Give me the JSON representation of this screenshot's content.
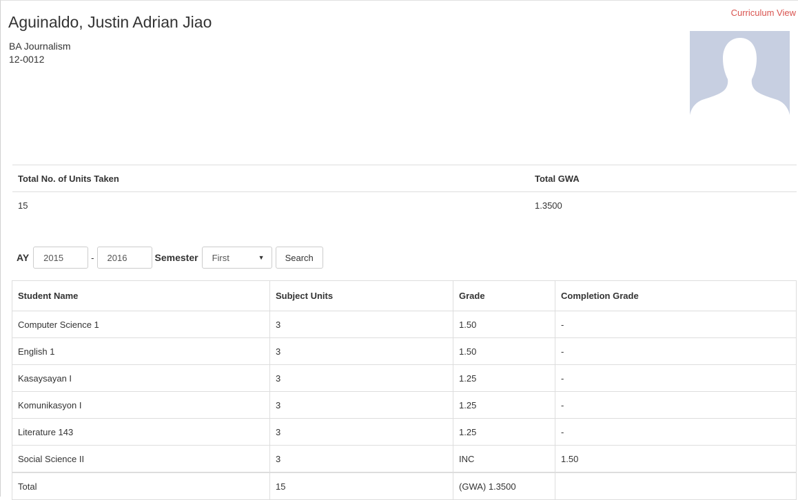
{
  "student": {
    "name": "Aguinaldo, Justin Adrian Jiao",
    "program": "BA Journalism",
    "id": "12-0012"
  },
  "links": {
    "curriculum_view": "Curriculum View"
  },
  "summary": {
    "units_label": "Total No. of Units Taken",
    "gwa_label": "Total GWA",
    "units_value": "15",
    "gwa_value": "1.3500"
  },
  "filter": {
    "ay_label": "AY",
    "ay_from": "2015",
    "dash": "-",
    "ay_to": "2016",
    "semester_label": "Semester",
    "semester_value": "First",
    "search_label": "Search"
  },
  "table": {
    "headers": [
      "Student Name",
      "Subject Units",
      "Grade",
      "Completion Grade"
    ],
    "rows": [
      [
        "Computer Science 1",
        "3",
        "1.50",
        "-"
      ],
      [
        "English 1",
        "3",
        "1.50",
        "-"
      ],
      [
        "Kasaysayan I",
        "3",
        "1.25",
        "-"
      ],
      [
        "Komunikasyon I",
        "3",
        "1.25",
        "-"
      ],
      [
        "Literature 143",
        "3",
        "1.25",
        "-"
      ],
      [
        "Social Science II",
        "3",
        "INC",
        "1.50"
      ]
    ],
    "total": [
      "Total",
      "15",
      "(GWA) 1.3500",
      ""
    ]
  },
  "colors": {
    "link": "#d9534f",
    "avatar_bg": "#c7cfe1"
  },
  "icons": {
    "avatar": "person-silhouette-icon",
    "select_caret": "caret-down-icon"
  }
}
